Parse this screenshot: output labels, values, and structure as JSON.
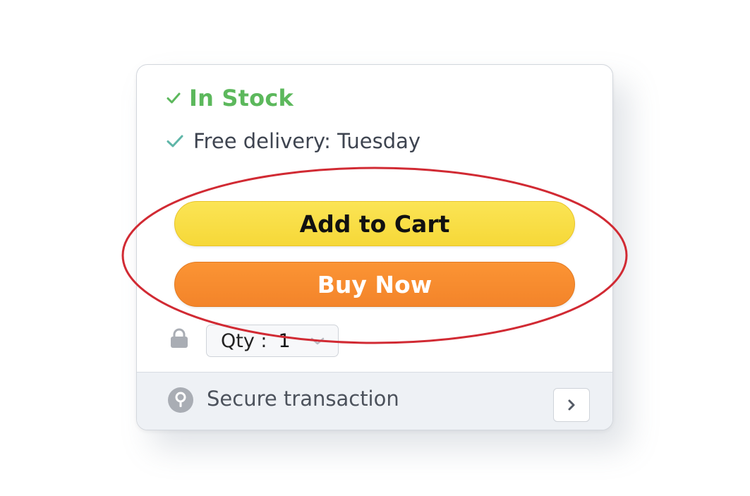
{
  "availability": {
    "stock_status": "In Stock",
    "stock_icon": "check-icon",
    "delivery_text": "Free delivery: Tuesday",
    "delivery_icon": "check-icon"
  },
  "buttons": {
    "add_to_cart": "Add to Cart",
    "buy_now": "Buy Now"
  },
  "quantity": {
    "label": "Qty :",
    "value": "1",
    "lock_icon": "lock-icon",
    "dropdown_icon": "chevron-down-icon"
  },
  "footer": {
    "secure_text": "Secure transaction",
    "shield_icon": "security-icon",
    "arrow_icon": "chevron-right-icon"
  },
  "colors": {
    "in_stock_green": "#5cb85c",
    "add_to_cart_yellow": "#f6d838",
    "buy_now_orange": "#f3842a",
    "highlight_red": "#d12a33"
  }
}
